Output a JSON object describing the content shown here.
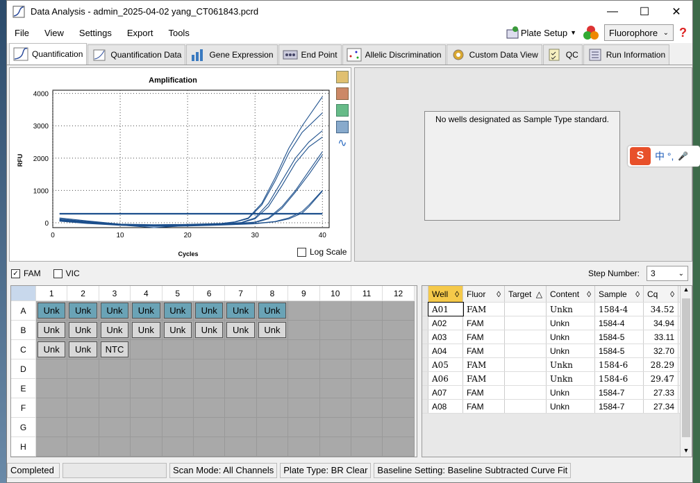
{
  "window": {
    "title": "Data Analysis - admin_2025-04-02 yang_CT061843.pcrd"
  },
  "menu": [
    "File",
    "View",
    "Settings",
    "Export",
    "Tools"
  ],
  "toolbar": {
    "plate_setup": "Plate Setup",
    "fluorophore": "Fluorophore",
    "help": "?"
  },
  "tabs": [
    "Quantification",
    "Quantification Data",
    "Gene Expression",
    "End Point",
    "Allelic Discrimination",
    "Custom Data View",
    "QC",
    "Run Information"
  ],
  "chart": {
    "log_scale_label": "Log Scale"
  },
  "chart_data": {
    "type": "line",
    "title": "Amplification",
    "xlabel": "Cycles",
    "ylabel": "RFU",
    "xlim": [
      0,
      41
    ],
    "ylim": [
      -150,
      4100
    ],
    "xticks": [
      0,
      10,
      20,
      30,
      40
    ],
    "yticks": [
      0,
      1000,
      2000,
      3000,
      4000
    ],
    "threshold": 280,
    "grid": true,
    "series": [
      {
        "x": [
          1,
          5,
          10,
          15,
          20,
          25,
          27,
          29,
          31,
          33,
          35,
          37,
          40
        ],
        "y": [
          150,
          60,
          -40,
          -60,
          -50,
          -20,
          30,
          150,
          600,
          1400,
          2300,
          3000,
          3900
        ]
      },
      {
        "x": [
          1,
          5,
          10,
          15,
          20,
          25,
          27,
          29,
          31,
          33,
          35,
          37,
          40
        ],
        "y": [
          120,
          40,
          -50,
          -70,
          -60,
          -30,
          20,
          130,
          550,
          1300,
          2150,
          2800,
          3400
        ]
      },
      {
        "x": [
          1,
          5,
          10,
          15,
          20,
          25,
          28,
          30,
          32,
          34,
          36,
          38,
          40
        ],
        "y": [
          100,
          30,
          -50,
          -70,
          -60,
          -40,
          10,
          150,
          600,
          1300,
          2000,
          2500,
          2850
        ]
      },
      {
        "x": [
          1,
          5,
          10,
          15,
          20,
          25,
          28,
          30,
          32,
          34,
          36,
          38,
          40
        ],
        "y": [
          90,
          20,
          -60,
          -80,
          -70,
          -40,
          0,
          120,
          500,
          1150,
          1850,
          2350,
          2650
        ]
      },
      {
        "x": [
          1,
          5,
          10,
          15,
          20,
          25,
          30,
          32,
          34,
          36,
          38,
          40
        ],
        "y": [
          80,
          10,
          -60,
          -90,
          -80,
          -50,
          20,
          150,
          500,
          1000,
          1600,
          2200
        ]
      },
      {
        "x": [
          1,
          5,
          10,
          15,
          20,
          25,
          30,
          32,
          34,
          36,
          38,
          40
        ],
        "y": [
          70,
          0,
          -70,
          -100,
          -90,
          -60,
          10,
          120,
          450,
          950,
          1500,
          2100
        ]
      },
      {
        "x": [
          1,
          5,
          10,
          15,
          20,
          25,
          30,
          33,
          35,
          37,
          38,
          40
        ],
        "y": [
          60,
          -10,
          -70,
          -150,
          -90,
          -60,
          -20,
          40,
          150,
          350,
          550,
          1000
        ]
      },
      {
        "x": [
          1,
          5,
          10,
          15,
          20,
          25,
          30,
          33,
          35,
          37,
          38,
          40
        ],
        "y": [
          50,
          -20,
          -80,
          -110,
          -100,
          -70,
          -30,
          30,
          120,
          300,
          500,
          980
        ]
      }
    ]
  },
  "std_message": "No wells designated as Sample Type standard.",
  "fluors": [
    {
      "label": "FAM",
      "checked": true
    },
    {
      "label": "VIC",
      "checked": false
    }
  ],
  "step": {
    "label": "Step Number:",
    "value": "3"
  },
  "plate": {
    "cols": [
      "1",
      "2",
      "3",
      "4",
      "5",
      "6",
      "7",
      "8",
      "9",
      "10",
      "11",
      "12"
    ],
    "rows": [
      "A",
      "B",
      "C",
      "D",
      "E",
      "F",
      "G",
      "H"
    ],
    "wells": {
      "A": [
        "Unk",
        "Unk",
        "Unk",
        "Unk",
        "Unk",
        "Unk",
        "Unk",
        "Unk"
      ],
      "B": [
        "Unk",
        "Unk",
        "Unk",
        "Unk",
        "Unk",
        "Unk",
        "Unk",
        "Unk"
      ],
      "C": [
        "Unk",
        "Unk",
        "NTC"
      ]
    }
  },
  "table": {
    "headers": [
      "Well",
      "Fluor",
      "Target",
      "Content",
      "Sample",
      "Cq"
    ],
    "rows": [
      [
        "A01",
        "FAM",
        "",
        "Unkn",
        "1584-4",
        "34.52"
      ],
      [
        "A02",
        "FAM",
        "",
        "Unkn",
        "1584-4",
        "34.94"
      ],
      [
        "A03",
        "FAM",
        "",
        "Unkn",
        "1584-5",
        "33.11"
      ],
      [
        "A04",
        "FAM",
        "",
        "Unkn",
        "1584-5",
        "32.70"
      ],
      [
        "A05",
        "FAM",
        "",
        "Unkn",
        "1584-6",
        "28.29"
      ],
      [
        "A06",
        "FAM",
        "",
        "Unkn",
        "1584-6",
        "29.47"
      ],
      [
        "A07",
        "FAM",
        "",
        "Unkn",
        "1584-7",
        "27.33"
      ],
      [
        "A08",
        "FAM",
        "",
        "Unkn",
        "1584-7",
        "27.34"
      ]
    ]
  },
  "status": {
    "state": "Completed",
    "scan": "Scan Mode: All Channels",
    "plate_type": "Plate Type: BR Clear",
    "baseline": "Baseline Setting: Baseline Subtracted Curve Fit"
  },
  "ime": {
    "text": "中 °,"
  }
}
